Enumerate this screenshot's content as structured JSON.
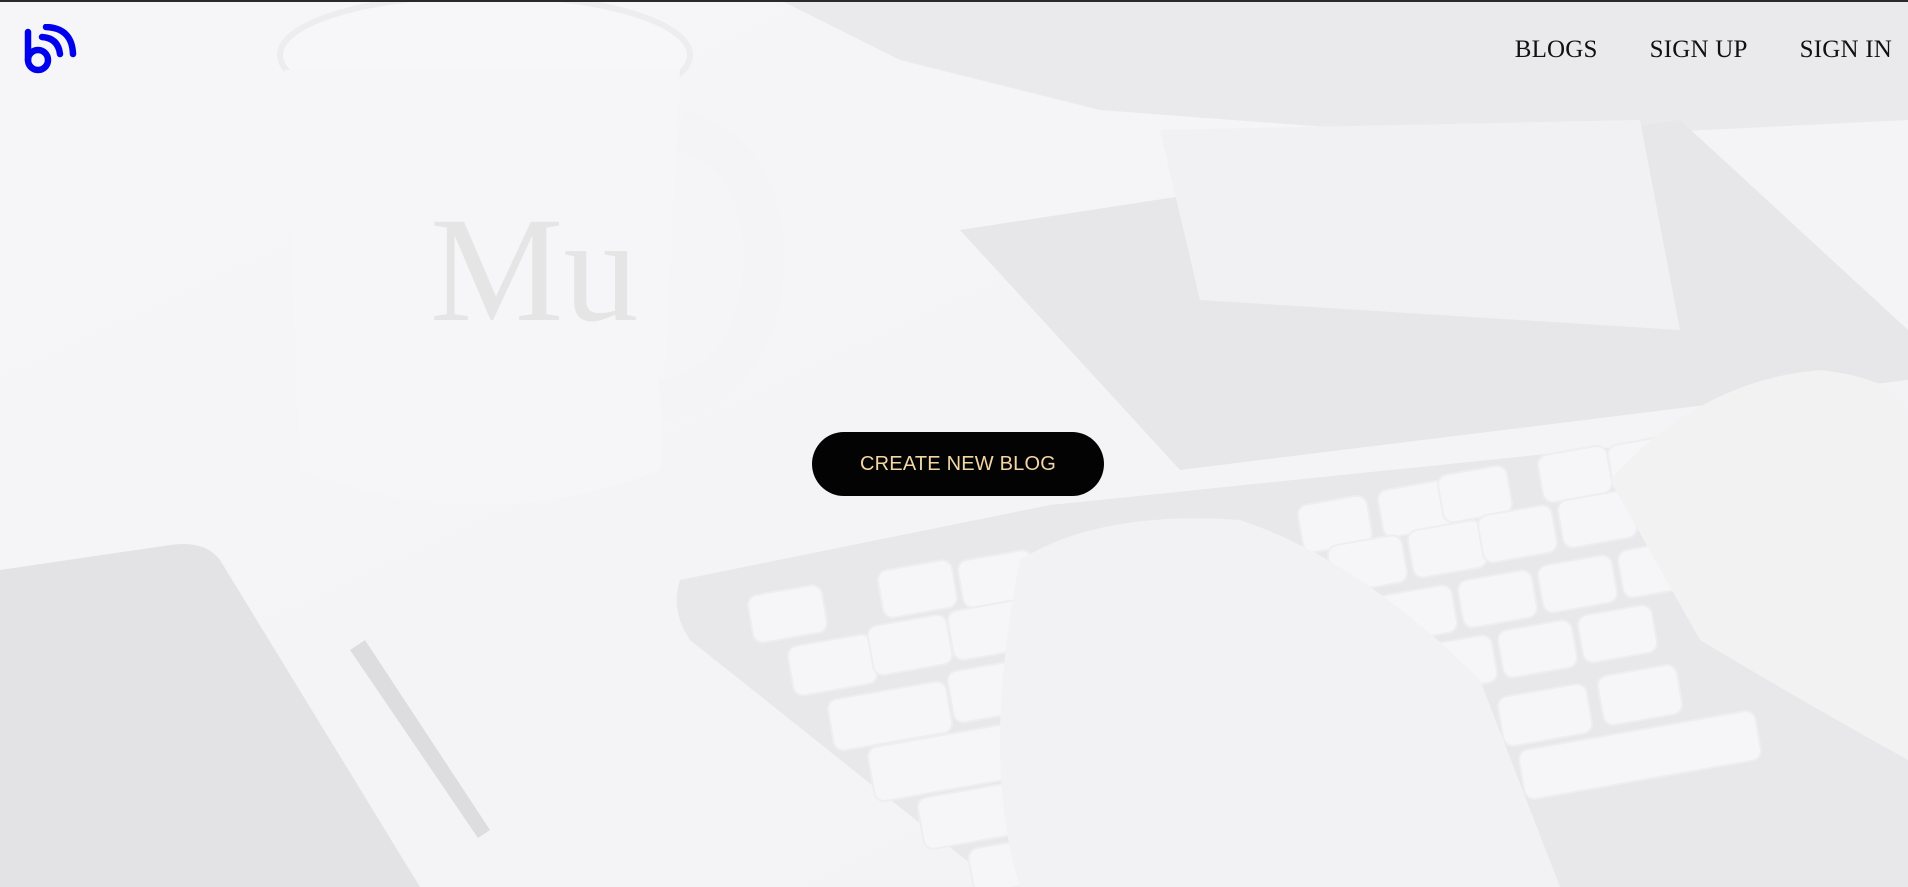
{
  "nav": {
    "items": [
      {
        "label": "BLOGS"
      },
      {
        "label": "SIGN UP"
      },
      {
        "label": "SIGN IN"
      }
    ]
  },
  "hero": {
    "cta_label": "CREATE NEW BLOG"
  },
  "logo": {
    "icon": "blog-logo-icon"
  },
  "colors": {
    "logo": "#0000ee",
    "cta_bg": "#030303",
    "cta_text": "#f3d6a4",
    "nav_text": "#111111"
  }
}
